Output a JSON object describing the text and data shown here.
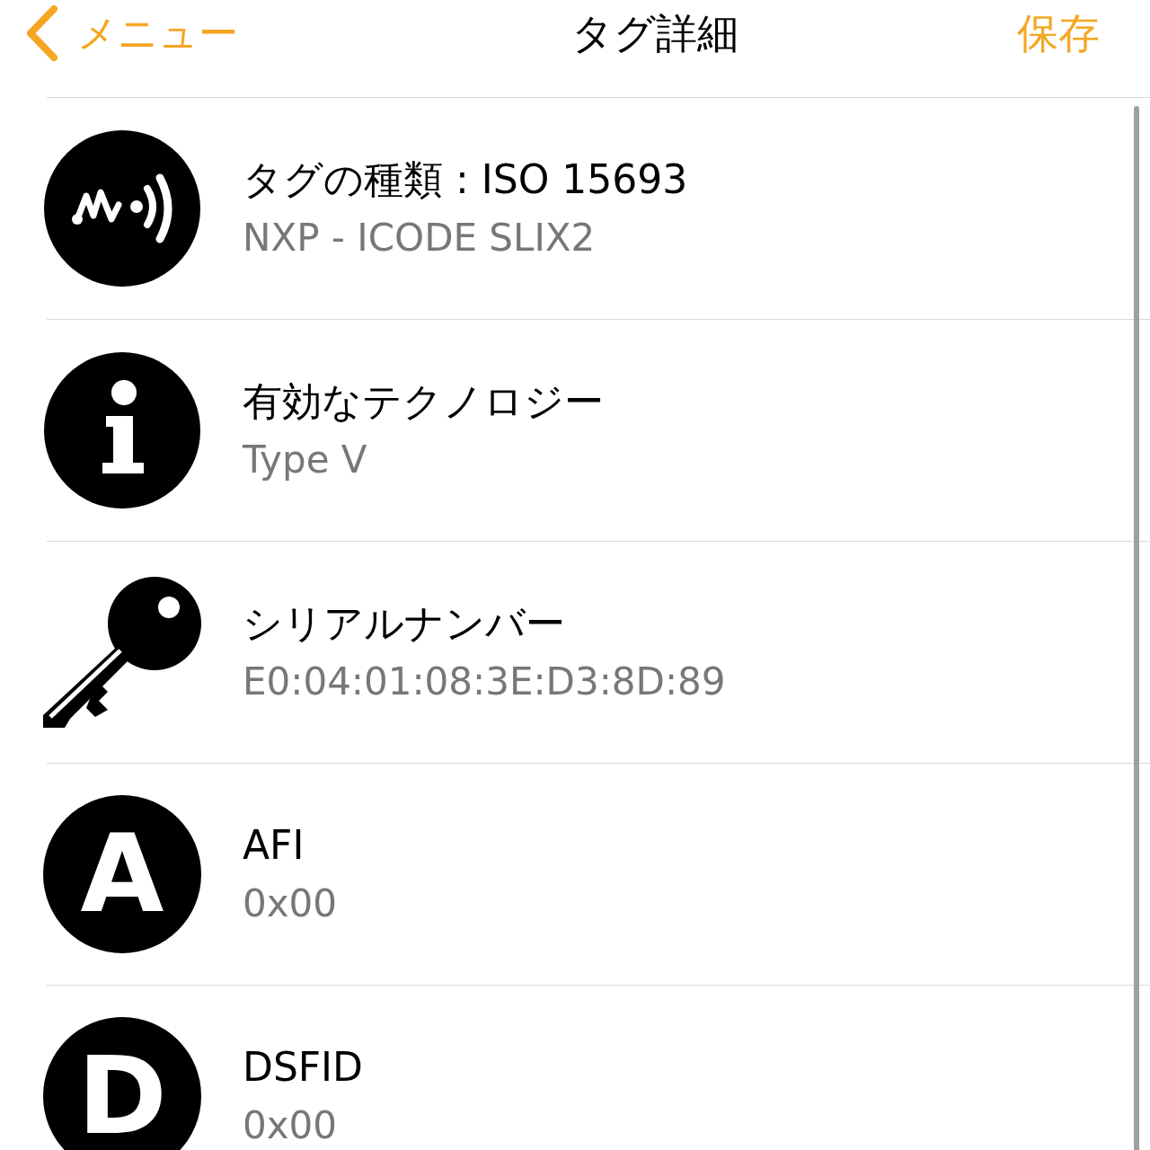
{
  "nav_bar": {
    "back_label": "メニュー",
    "title": "タグ詳細",
    "action": "保存"
  },
  "items": [
    {
      "kind": "nfc",
      "title": "タグの種類 : ISO 15693",
      "value": "NXP - ICODE SLIX2"
    },
    {
      "kind": "info",
      "title": "有効なテクノロジー",
      "value": "Type V"
    },
    {
      "kind": "key",
      "title": "シリアルナンバー",
      "value": "E0:04:01:08:3E:D3:8D:89"
    },
    {
      "kind": "letter",
      "letter": "A",
      "title": "AFI",
      "value": "0x00"
    },
    {
      "kind": "letter",
      "letter": "D",
      "title": "DSFID",
      "value": "0x00"
    }
  ]
}
